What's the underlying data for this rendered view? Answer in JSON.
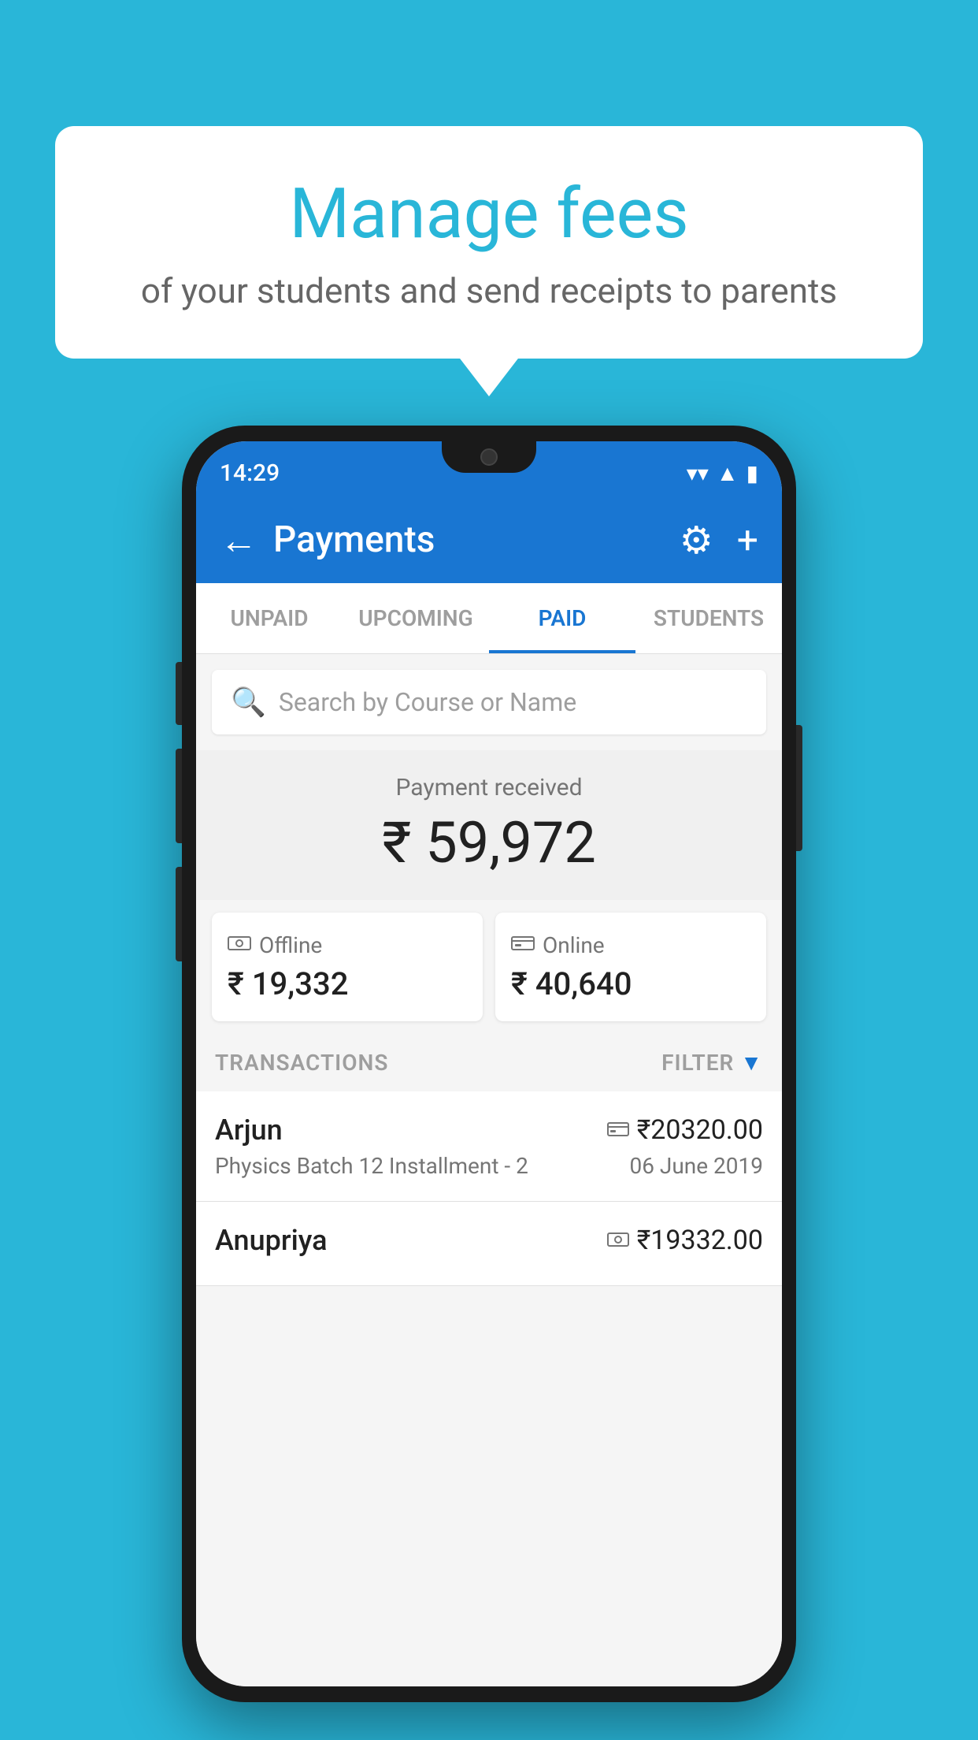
{
  "background": {
    "color": "#29B6D8"
  },
  "speech_bubble": {
    "title": "Manage fees",
    "subtitle": "of your students and send receipts to parents"
  },
  "status_bar": {
    "time": "14:29",
    "wifi_icon": "▼",
    "signal_icon": "▲",
    "battery_icon": "▮"
  },
  "app_bar": {
    "title": "Payments",
    "back_icon": "←",
    "gear_icon": "⚙",
    "plus_icon": "+"
  },
  "tabs": [
    {
      "label": "UNPAID",
      "active": false
    },
    {
      "label": "UPCOMING",
      "active": false
    },
    {
      "label": "PAID",
      "active": true
    },
    {
      "label": "STUDENTS",
      "active": false
    }
  ],
  "search": {
    "placeholder": "Search by Course or Name",
    "icon": "🔍"
  },
  "payment_summary": {
    "label": "Payment received",
    "amount": "₹ 59,972"
  },
  "payment_cards": [
    {
      "icon": "offline",
      "label": "Offline",
      "amount": "₹ 19,332"
    },
    {
      "icon": "online",
      "label": "Online",
      "amount": "₹ 40,640"
    }
  ],
  "transactions_section": {
    "label": "TRANSACTIONS",
    "filter_label": "FILTER"
  },
  "transactions": [
    {
      "name": "Arjun",
      "detail": "Physics Batch 12 Installment - 2",
      "amount": "₹20320.00",
      "date": "06 June 2019",
      "payment_type": "card"
    },
    {
      "name": "Anupriya",
      "detail": "",
      "amount": "₹19332.00",
      "date": "",
      "payment_type": "cash"
    }
  ]
}
